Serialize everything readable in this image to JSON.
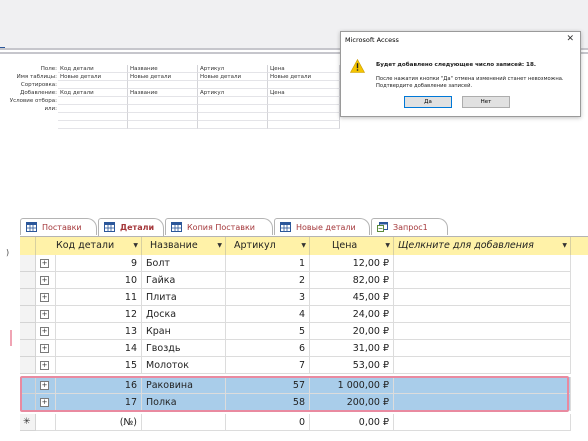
{
  "qbe": {
    "row_labels": [
      "Поле:",
      "Имя таблицы:",
      "Сортировка:",
      "Добавление:",
      "Условие отбора:",
      "или:"
    ],
    "columns": [
      {
        "field": "Код детали",
        "table": "Новые детали",
        "append": "Код детали"
      },
      {
        "field": "Название",
        "table": "Новые детали",
        "append": "Название"
      },
      {
        "field": "Артикул",
        "table": "Новые детали",
        "append": "Артикул"
      },
      {
        "field": "Цена",
        "table": "Новые детали",
        "append": "Цена"
      }
    ]
  },
  "dialog": {
    "title": "Microsoft Access",
    "close": "✕",
    "heading": "Будет добавлено следующее число записей: 18.",
    "line1": "После нажатия кнопки \"Да\" отмена изменений станет невозможна.",
    "line2": "Подтвердите добавление записей.",
    "yes_label": "Да",
    "no_label": "Нет"
  },
  "tabs": [
    {
      "label": "Поставки",
      "active": false
    },
    {
      "label": "Детали",
      "active": true
    },
    {
      "label": "Копия Поставки",
      "active": false
    },
    {
      "label": "Новые детали",
      "active": false
    },
    {
      "label": "Запрос1",
      "active": false
    }
  ],
  "table": {
    "headers": [
      "Код детали",
      "Название",
      "Артикул",
      "Цена",
      "Щелкните для добавления"
    ],
    "rows": [
      {
        "code": "9",
        "name": "Болт",
        "art": "1",
        "price": "12,00 ₽",
        "highlight": false
      },
      {
        "code": "10",
        "name": "Гайка",
        "art": "2",
        "price": "82,00 ₽",
        "highlight": false
      },
      {
        "code": "11",
        "name": "Плита",
        "art": "3",
        "price": "45,00 ₽",
        "highlight": false
      },
      {
        "code": "12",
        "name": "Доска",
        "art": "4",
        "price": "24,00 ₽",
        "highlight": false
      },
      {
        "code": "13",
        "name": "Кран",
        "art": "5",
        "price": "20,00 ₽",
        "highlight": false
      },
      {
        "code": "14",
        "name": "Гвоздь",
        "art": "6",
        "price": "31,00 ₽",
        "highlight": false
      },
      {
        "code": "15",
        "name": "Молоток",
        "art": "7",
        "price": "53,00 ₽",
        "highlight": false
      },
      {
        "code": "16",
        "name": "Раковина",
        "art": "57",
        "price": "1 000,00 ₽",
        "highlight": true
      },
      {
        "code": "17",
        "name": "Полка",
        "art": "58",
        "price": "200,00 ₽",
        "highlight": true
      }
    ],
    "new_row": {
      "marker": "✳",
      "code": "(№)",
      "art": "0",
      "price": "0,00 ₽"
    },
    "plus": "+",
    "sort_arrow": "▼"
  },
  "colors": {
    "header_bg": "#fff2a8",
    "highlight_bg": "#a9cdea",
    "highlight_border": "#e98aa0",
    "tab_text": "#a4373a"
  },
  "left_marker": ")"
}
